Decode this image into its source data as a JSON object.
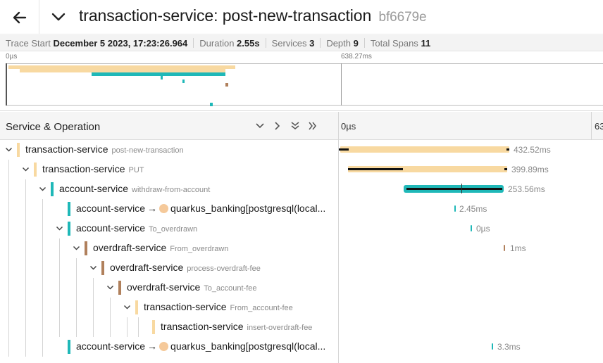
{
  "header": {
    "title": "transaction-service: post-new-transaction",
    "trace_id": "bf6679e"
  },
  "summary": {
    "trace_start_label": "Trace Start",
    "trace_start_value": "December 5 2023, 17:23:26",
    "trace_start_ms": ".964",
    "duration_label": "Duration",
    "duration_value": "2.55s",
    "services_label": "Services",
    "services_value": "3",
    "depth_label": "Depth",
    "depth_value": "9",
    "total_spans_label": "Total Spans",
    "total_spans_value": "11"
  },
  "minimap": {
    "tick_start": "0µs",
    "tick_mid": "638.27ms"
  },
  "table": {
    "column_title": "Service & Operation",
    "timeline_tick_start": "0µs",
    "timeline_tick_end": "63"
  },
  "colors": {
    "transaction_service": "#f8d9a1",
    "account_service": "#1fb8b8",
    "overdraft_service": "#b0805c",
    "db_dot": "#f5c99a"
  },
  "rows": [
    {
      "service": "transaction-service",
      "operation": "post-new-transaction",
      "duration": "432.52ms"
    },
    {
      "service": "transaction-service",
      "operation": "PUT",
      "duration": "399.89ms"
    },
    {
      "service": "account-service",
      "operation": "withdraw-from-account",
      "duration": "253.56ms"
    },
    {
      "service": "account-service",
      "arrow": "→",
      "peer": "quarkus_banking[postgresql(local...",
      "duration": "2.45ms"
    },
    {
      "service": "account-service",
      "operation": "To_overdrawn",
      "duration": "0µs"
    },
    {
      "service": "overdraft-service",
      "operation": "From_overdrawn",
      "duration": "1ms"
    },
    {
      "service": "overdraft-service",
      "operation": "process-overdraft-fee",
      "duration": ""
    },
    {
      "service": "overdraft-service",
      "operation": "To_account-fee",
      "duration": ""
    },
    {
      "service": "transaction-service",
      "operation": "From_account-fee",
      "duration": ""
    },
    {
      "service": "transaction-service",
      "operation": "insert-overdraft-fee",
      "duration": ""
    },
    {
      "service": "account-service",
      "arrow": "→",
      "peer": "quarkus_banking[postgresql(local...",
      "duration": "3.3ms"
    }
  ]
}
